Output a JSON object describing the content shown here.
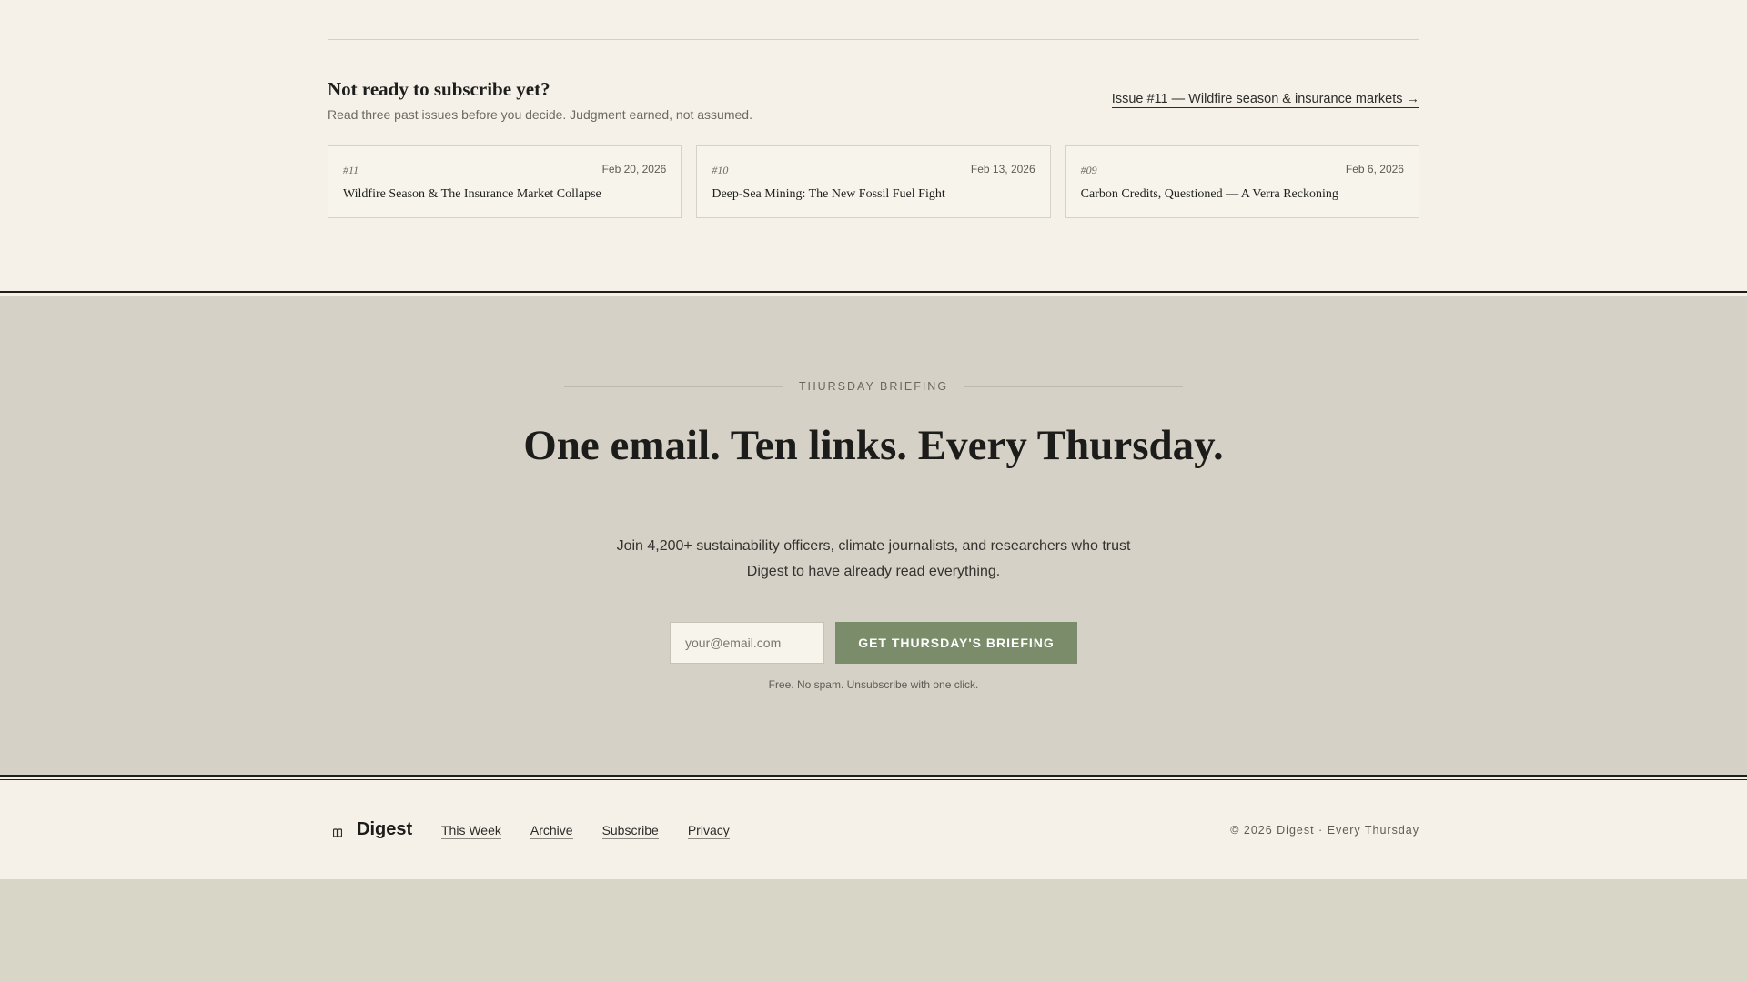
{
  "preview": {
    "title": "Not ready to subscribe yet?",
    "subtitle": "Read three past issues before you decide. Judgment earned, not assumed.",
    "latest_link": "Issue #11 — Wildfire season & insurance markets →",
    "issues": [
      {
        "number": "#11",
        "date": "Feb 20, 2026",
        "title": "Wildfire Season & The Insurance Market Collapse"
      },
      {
        "number": "#10",
        "date": "Feb 13, 2026",
        "title": "Deep-Sea Mining: The New Fossil Fuel Fight"
      },
      {
        "number": "#09",
        "date": "Feb 6, 2026",
        "title": "Carbon Credits, Questioned — A Verra Reckoning"
      }
    ]
  },
  "cta": {
    "kicker": "THURSDAY BRIEFING",
    "headline": "One email. Ten links. Every Thursday.",
    "lead": "Join 4,200+ sustainability officers, climate journalists, and researchers who trust Digest to have already read everything.",
    "email_placeholder": "your@email.com",
    "button_label": "GET THURSDAY'S BRIEFING",
    "fine_print": "Free. No spam. Unsubscribe with one click."
  },
  "footer": {
    "brand": "Digest",
    "brand_icon": "book-icon",
    "nav": [
      "This Week",
      "Archive",
      "Subscribe",
      "Privacy"
    ],
    "copyright": "© 2026 Digest · Every Thursday"
  },
  "colors": {
    "accent": "#7a8c69",
    "paper": "#f5f1e8",
    "band": "#d6d1c7"
  }
}
